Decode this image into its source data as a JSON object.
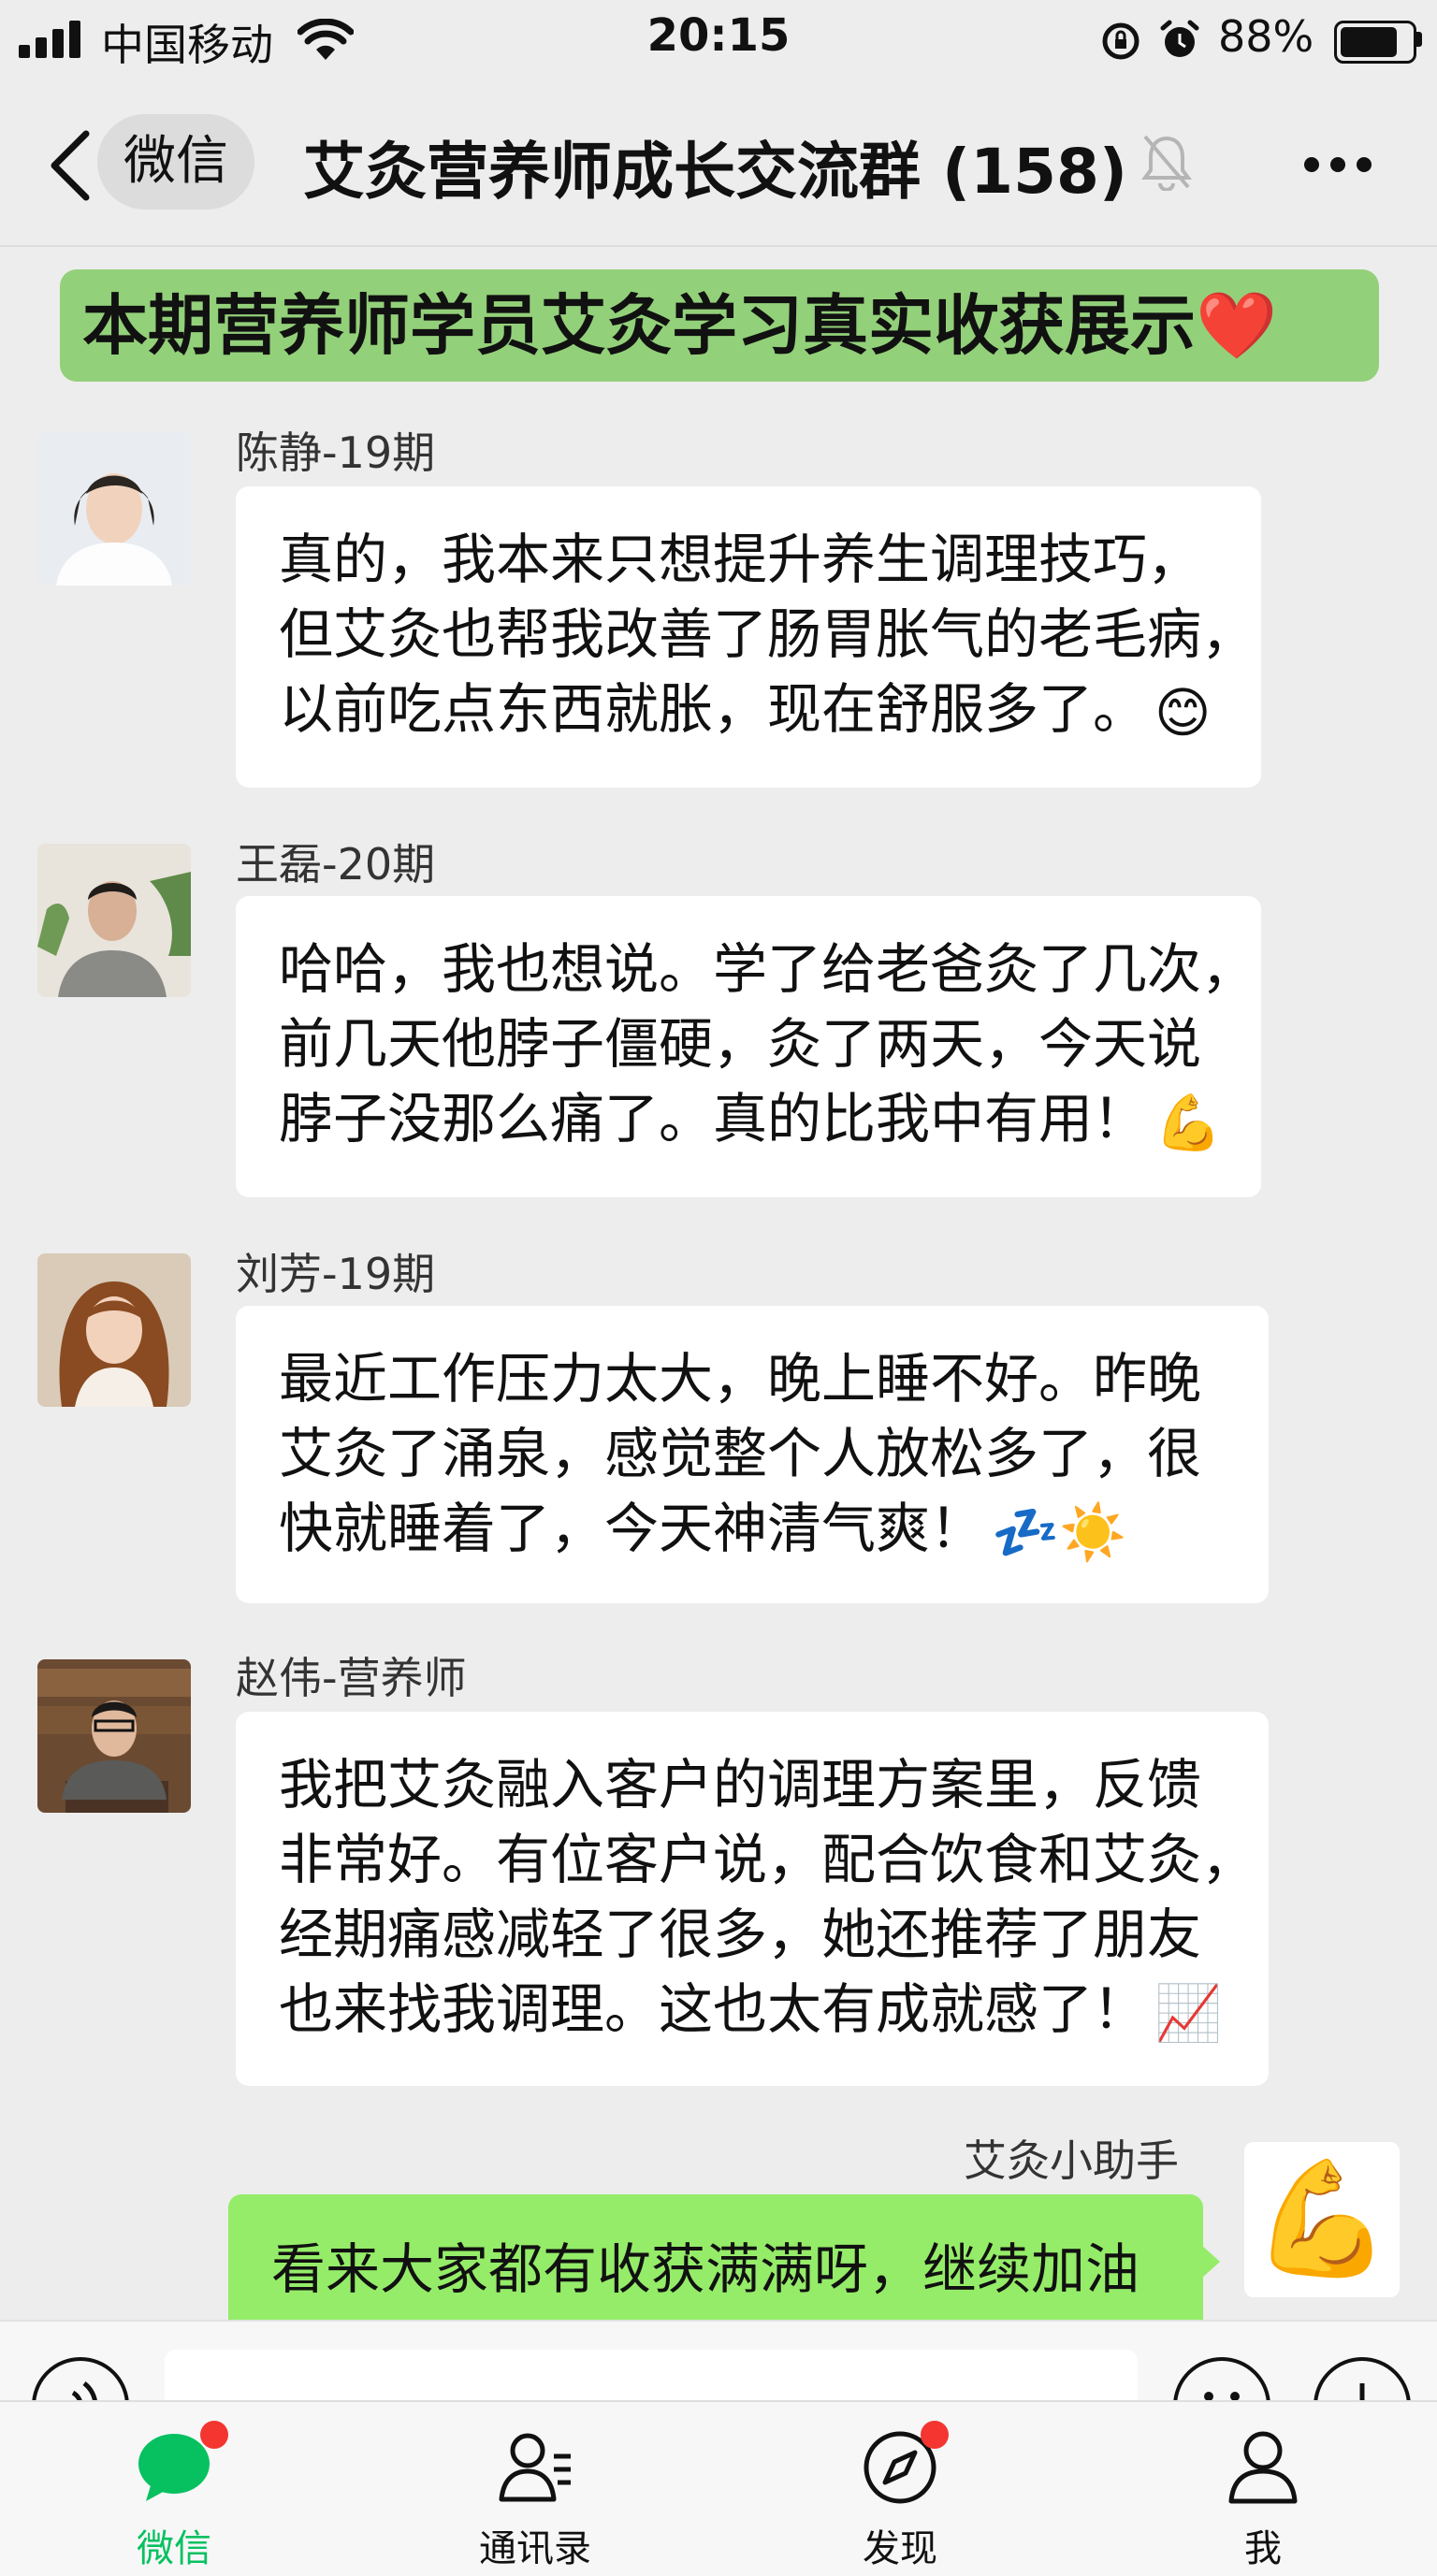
{
  "status_bar": {
    "carrier": "中国移动",
    "time": "20:15",
    "battery_percent_text": "88%",
    "battery_level": 0.88
  },
  "nav": {
    "back_label": "微信",
    "title": "艾灸营养师成长交流群 (158)"
  },
  "banner": {
    "text": "本期营养师学员艾灸学习真实收获展示❤️"
  },
  "messages": [
    {
      "sender": "陈静-19期",
      "lines": [
        "真的，我本来只想提升养生调理技巧，",
        "但艾灸也帮我改善了肠胃胀气的老毛病，",
        "以前吃点东西就胀，现在舒服多了。"
      ],
      "emoji": "😊"
    },
    {
      "sender": "王磊-20期",
      "lines": [
        "哈哈，我也想说。学了给老爸灸了几次，",
        "前几天他脖子僵硬，灸了两天，今天说",
        "脖子没那么痛了。真的比我中有用！"
      ],
      "emoji": "💪"
    },
    {
      "sender": "刘芳-19期",
      "lines": [
        "最近工作压力太大，晚上睡不好。昨晚",
        "艾灸了涌泉，感觉整个人放松多了，很",
        "快就睡着了，今天神清气爽！"
      ],
      "emoji": "💤☀️"
    },
    {
      "sender": "赵伟-营养师",
      "lines": [
        "我把艾灸融入客户的调理方案里，反馈",
        "非常好。有位客户说，配合饮食和艾灸，",
        "经期痛感减轻了很多，她还推荐了朋友",
        "也来找我调理。这也太有成就感了！"
      ],
      "emoji": "📈"
    }
  ],
  "self_message": {
    "sender": "艾灸小助手",
    "text": "看来大家都有收获满满呀，继续加油",
    "avatar_emoji": "💪"
  },
  "tabs": [
    {
      "label": "微信",
      "icon": "chat-bubble-icon",
      "active": true,
      "badge": true
    },
    {
      "label": "通讯录",
      "icon": "contacts-icon",
      "active": false,
      "badge": false
    },
    {
      "label": "发现",
      "icon": "compass-icon",
      "active": false,
      "badge": true
    },
    {
      "label": "我",
      "icon": "person-icon",
      "active": false,
      "badge": false
    }
  ],
  "colors": {
    "accent": "#07c160",
    "banner_bg": "#93d07a",
    "self_bubble": "#95ec69",
    "badge": "#f43530"
  }
}
